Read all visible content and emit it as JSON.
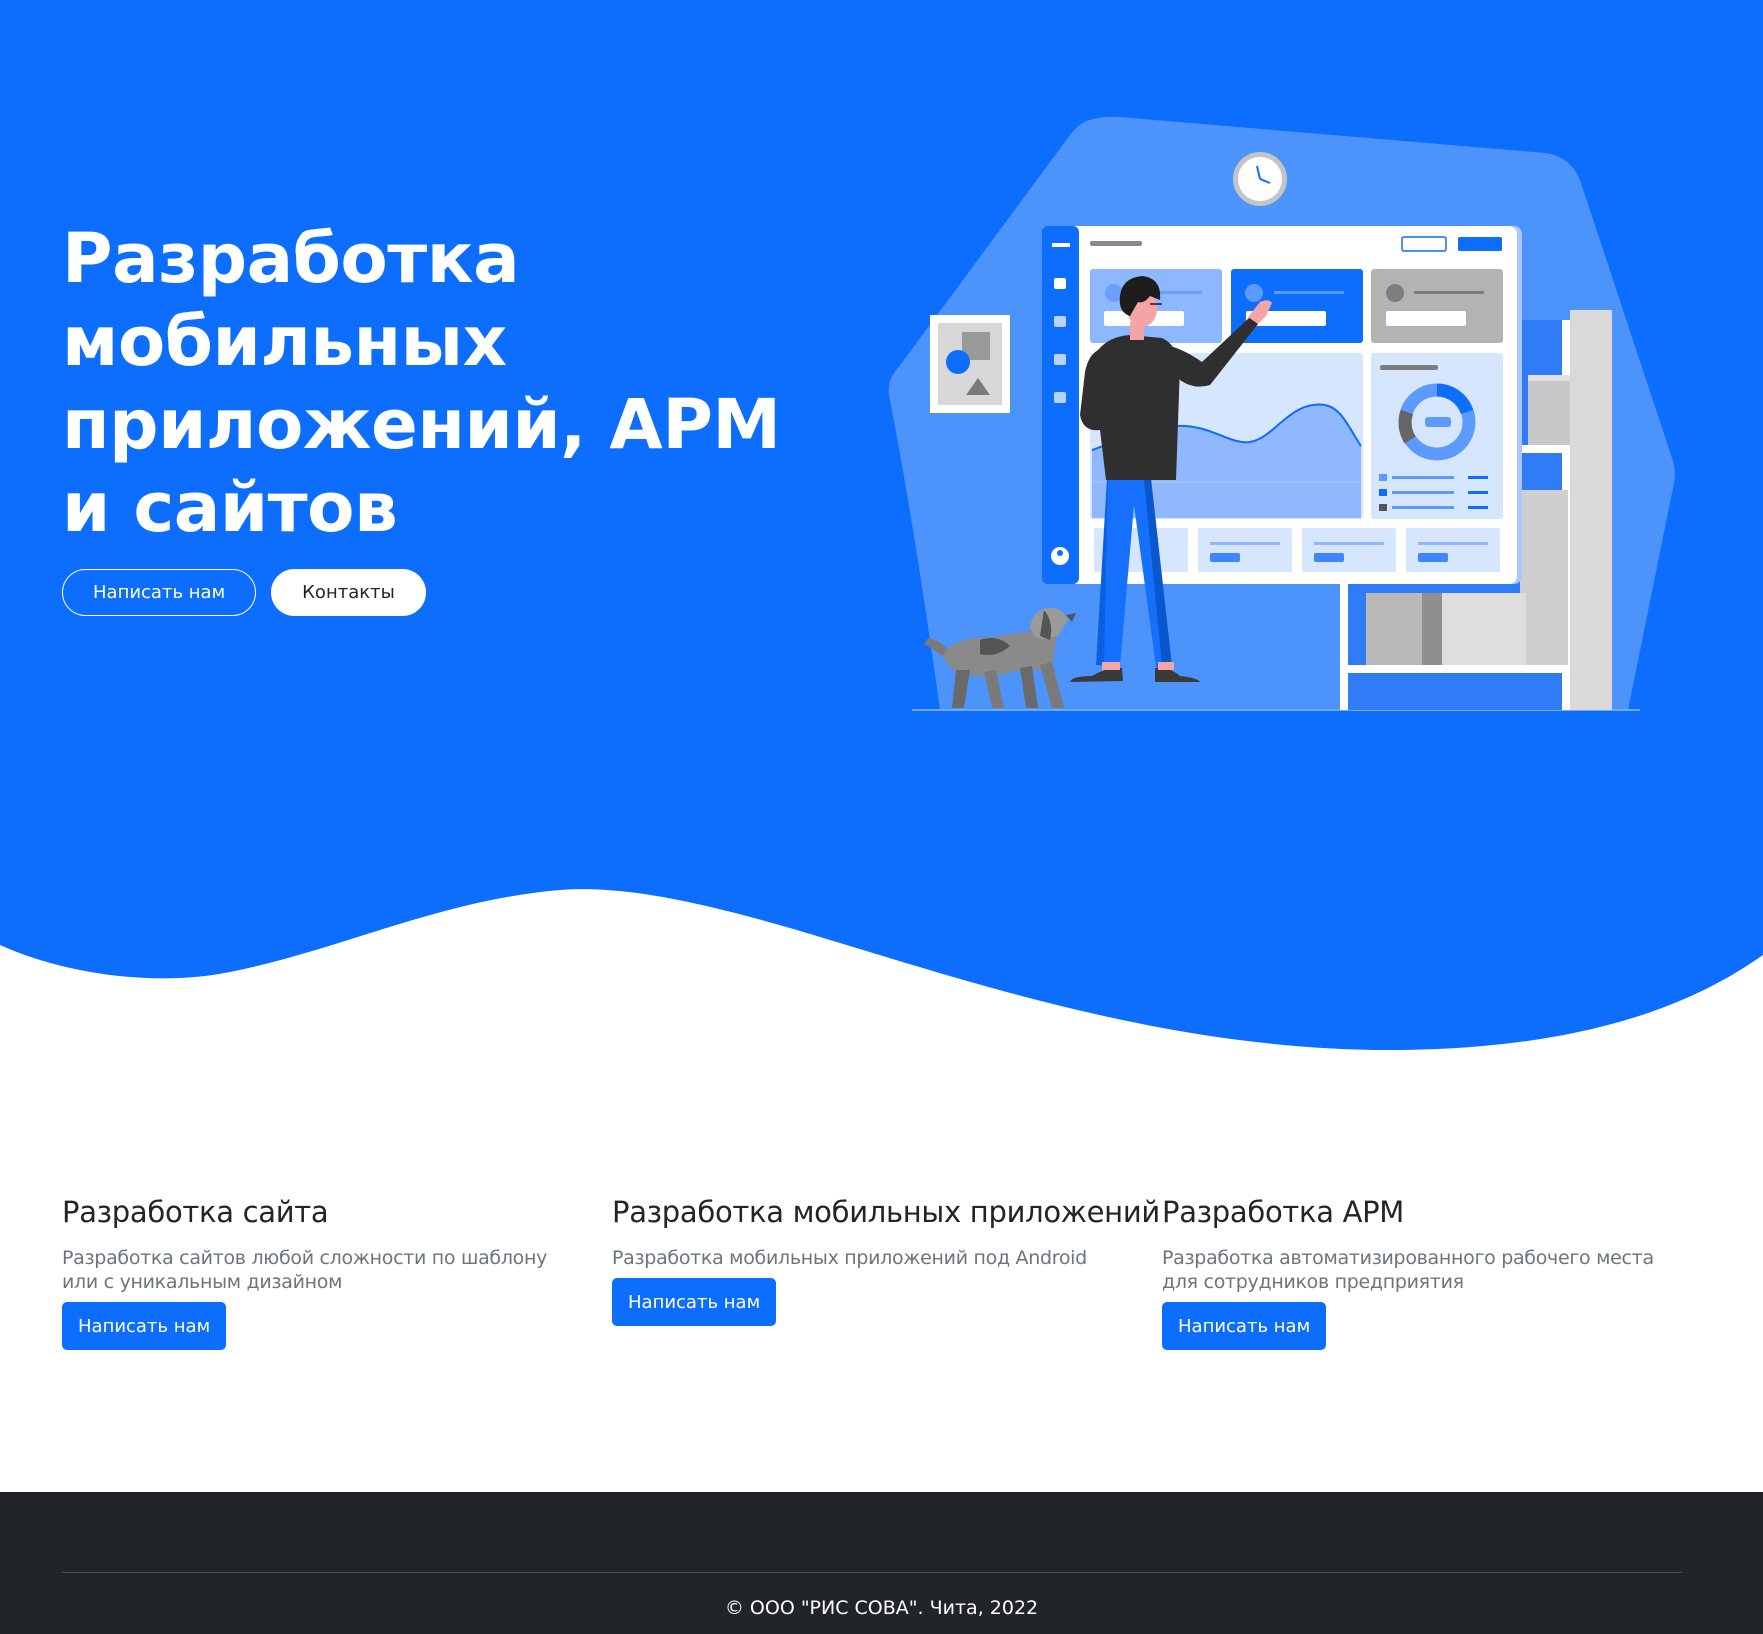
{
  "colors": {
    "primary": "#0d6efd",
    "footer_bg": "#212529",
    "text_dark": "#212529",
    "text_muted": "#6c757d"
  },
  "hero": {
    "title": "Разработка мобильных приложений, АРМ и сайтов",
    "write_button": "Написать нам",
    "contacts_button": "Контакты"
  },
  "features": [
    {
      "title": "Разработка сайта",
      "description": "Разработка сайтов любой сложности по шаблону или с уникальным дизайном",
      "button": "Написать нам"
    },
    {
      "title": "Разработка мобильных приложений",
      "description": "Разработка мобильных приложений под Android",
      "button": "Написать нам"
    },
    {
      "title": "Разработка АРМ",
      "description": "Разработка автоматизированного рабочего места для сотрудников предприятия",
      "button": "Написать нам"
    }
  ],
  "footer": {
    "copyright": "© ООО \"РИС СОВА\". Чита, 2022"
  }
}
